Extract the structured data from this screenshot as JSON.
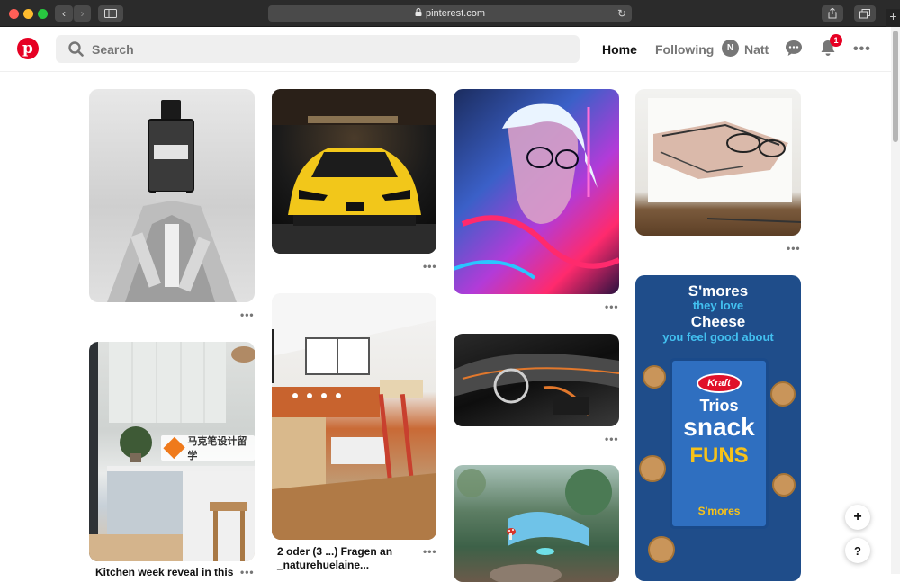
{
  "browser": {
    "url": "pinterest.com"
  },
  "header": {
    "search_placeholder": "Search",
    "nav": {
      "home": "Home",
      "following": "Following"
    },
    "user": {
      "initial": "N",
      "name": "Natt"
    },
    "notifications_count": "1"
  },
  "pins": [
    {
      "id": "perfume",
      "title": ""
    },
    {
      "id": "lamborghini",
      "title": ""
    },
    {
      "id": "neon-portrait",
      "title": ""
    },
    {
      "id": "sketch",
      "title": ""
    },
    {
      "id": "kitchen",
      "title": "Kitchen week reveal in this"
    },
    {
      "id": "loft",
      "title": "2 oder (3 ...) Fragen an _naturehuelaine..."
    },
    {
      "id": "car-interior",
      "title": ""
    },
    {
      "id": "garden",
      "title": ""
    },
    {
      "id": "smores",
      "title": ""
    }
  ],
  "smores_ad": {
    "line1": "S'mores",
    "line2": "they love",
    "line3": "Cheese",
    "line4": "you feel good about",
    "brand": "Kraft",
    "product_top": "Trios",
    "product_mid": "snack",
    "product_bottom": "FUNS",
    "flavor": "S'mores"
  },
  "watermark_text": "马克笔设计留学",
  "colors": {
    "brand": "#e60023",
    "text": "#111111",
    "muted": "#767676"
  }
}
